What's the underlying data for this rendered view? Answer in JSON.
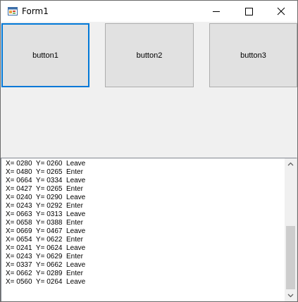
{
  "window": {
    "title": "Form1",
    "icon": "winforms-app-icon",
    "controls": [
      "minimize-icon",
      "maximize-icon",
      "close-icon"
    ]
  },
  "buttons": [
    {
      "label": "button1",
      "focused": true
    },
    {
      "label": "button2",
      "focused": false
    },
    {
      "label": "button3",
      "focused": false
    }
  ],
  "colors": {
    "focus_border": "#0078d7",
    "button_face": "#e1e1e1",
    "form_background": "#f0f0f0",
    "scroll_thumb": "#cdcdcd"
  },
  "log": [
    {
      "text": "X= 0280  Y= 0260  Leave"
    },
    {
      "text": "X= 0480  Y= 0265  Enter"
    },
    {
      "text": "X= 0664  Y= 0334  Leave"
    },
    {
      "text": "X= 0427  Y= 0265  Enter"
    },
    {
      "text": "X= 0240  Y= 0290  Leave"
    },
    {
      "text": "X= 0243  Y= 0292  Enter"
    },
    {
      "text": "X= 0663  Y= 0313  Leave"
    },
    {
      "text": "X= 0658  Y= 0388  Enter"
    },
    {
      "text": "X= 0669  Y= 0467  Leave"
    },
    {
      "text": "X= 0654  Y= 0622  Enter"
    },
    {
      "text": "X= 0241  Y= 0624  Leave"
    },
    {
      "text": "X= 0243  Y= 0629  Enter"
    },
    {
      "text": "X= 0337  Y= 0662  Leave"
    },
    {
      "text": "X= 0662  Y= 0289  Enter"
    },
    {
      "text": "X= 0560  Y= 0264  Leave"
    }
  ],
  "scrollbar": {
    "position": 1.0
  }
}
